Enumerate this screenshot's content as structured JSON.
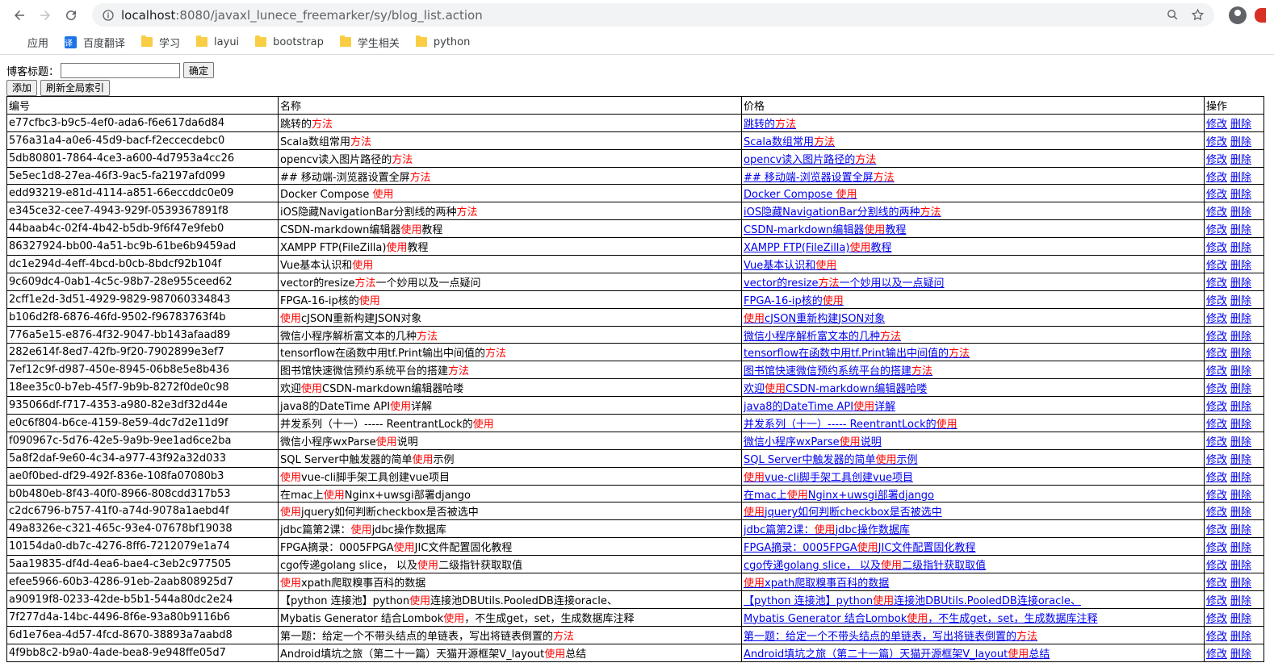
{
  "browser": {
    "url_host": "localhost",
    "url_path": ":8080/javaxl_lunece_freemarker/sy/blog_list.action",
    "bookmarks": [
      {
        "label": "应用",
        "icon": "apps-icon"
      },
      {
        "label": "百度翻译",
        "icon": "translate-icon"
      },
      {
        "label": "学习",
        "icon": "folder-icon"
      },
      {
        "label": "layui",
        "icon": "folder-icon"
      },
      {
        "label": "bootstrap",
        "icon": "folder-icon"
      },
      {
        "label": "学生相关",
        "icon": "folder-icon"
      },
      {
        "label": "python",
        "icon": "folder-icon"
      }
    ]
  },
  "search": {
    "label": "博客标题：",
    "value": "",
    "submit_label": "确定"
  },
  "actions": {
    "add_label": "添加",
    "refresh_label": "刷新全局索引"
  },
  "table": {
    "headers": [
      "编号",
      "名称",
      "价格",
      "操作"
    ],
    "edit_label": "修改",
    "delete_label": "删除",
    "highlight_color": "#ff0000",
    "rows": [
      {
        "id": "e77cfbc3-b9c5-4ef0-ada6-f6e617da6d84",
        "name": [
          [
            "跳转的",
            false
          ],
          [
            "方法",
            true
          ]
        ]
      },
      {
        "id": "576a31a4-a0e6-45d9-bacf-f2eccecdebc0",
        "name": [
          [
            "Scala数组常用",
            false
          ],
          [
            "方法",
            true
          ]
        ]
      },
      {
        "id": "5db80801-7864-4ce3-a600-4d7953a4cc26",
        "name": [
          [
            "opencv读入图片路径的",
            false
          ],
          [
            "方法",
            true
          ]
        ]
      },
      {
        "id": "5e5ec1d8-27ea-46f3-9ac5-fa2197afd099",
        "name": [
          [
            "## 移动端-浏览器设置全屏",
            false
          ],
          [
            "方法",
            true
          ]
        ]
      },
      {
        "id": "edd93219-e81d-4114-a851-66eccddc0e09",
        "name": [
          [
            "Docker Compose ",
            false
          ],
          [
            "使用",
            true
          ]
        ]
      },
      {
        "id": "e345ce32-cee7-4943-929f-0539367891f8",
        "name": [
          [
            "iOS隐藏NavigationBar分割线的两种",
            false
          ],
          [
            "方法",
            true
          ]
        ]
      },
      {
        "id": "44baab4c-02f4-4b42-b5db-9f6f47e9feb0",
        "name": [
          [
            "CSDN-markdown编辑器",
            false
          ],
          [
            "使用",
            true
          ],
          [
            "教程",
            false
          ]
        ]
      },
      {
        "id": "86327924-bb00-4a51-bc9b-61be6b9459ad",
        "name": [
          [
            "XAMPP FTP(FileZilla)",
            false
          ],
          [
            "使用",
            true
          ],
          [
            "教程",
            false
          ]
        ]
      },
      {
        "id": "dc1e294d-4eff-4bcd-b0cb-8bdcf92b104f",
        "name": [
          [
            "Vue基本认识和",
            false
          ],
          [
            "使用",
            true
          ]
        ]
      },
      {
        "id": "9c609dc4-0ab1-4c5c-98b7-28e955ceed62",
        "name": [
          [
            "vector的resize",
            false
          ],
          [
            "方法",
            true
          ],
          [
            "一个妙用以及一点疑问",
            false
          ]
        ]
      },
      {
        "id": "2cff1e2d-3d51-4929-9829-987060334843",
        "name": [
          [
            "FPGA-16-ip核的",
            false
          ],
          [
            "使用",
            true
          ]
        ]
      },
      {
        "id": "b106d2f8-6876-46fd-9502-f96783763f4b",
        "name": [
          [
            "使用",
            true
          ],
          [
            "cJSON重新构建JSON对象",
            false
          ]
        ]
      },
      {
        "id": "776a5e15-e876-4f32-9047-bb143afaad89",
        "name": [
          [
            "微信小程序解析富文本的几种",
            false
          ],
          [
            "方法",
            true
          ]
        ]
      },
      {
        "id": "282e614f-8ed7-42fb-9f20-7902899e3ef7",
        "name": [
          [
            "tensorflow在函数中用tf.Print输出中间值的",
            false
          ],
          [
            "方法",
            true
          ]
        ]
      },
      {
        "id": "7ef12c9f-d987-450e-8945-06b8e5e8b436",
        "name": [
          [
            "图书馆快速微信预约系统平台的搭建",
            false
          ],
          [
            "方法",
            true
          ]
        ]
      },
      {
        "id": "18ee35c0-b7eb-45f7-9b9b-8272f0de0c98",
        "name": [
          [
            "欢迎",
            false
          ],
          [
            "使用",
            true
          ],
          [
            "CSDN-markdown编辑器哈喽",
            false
          ]
        ]
      },
      {
        "id": "935066df-f717-4353-a980-82e3df32d44e",
        "name": [
          [
            "java8的DateTime API",
            false
          ],
          [
            "使用",
            true
          ],
          [
            "详解",
            false
          ]
        ]
      },
      {
        "id": "e0c6f804-b6ce-4159-8e59-4dc7d2e11d9f",
        "name": [
          [
            "并发系列（十一）----- ReentrantLock的",
            false
          ],
          [
            "使用",
            true
          ]
        ]
      },
      {
        "id": "f090967c-5d76-42e5-9a9b-9ee1ad6ce2ba",
        "name": [
          [
            "微信小程序wxParse",
            false
          ],
          [
            "使用",
            true
          ],
          [
            "说明",
            false
          ]
        ]
      },
      {
        "id": "5a8f2daf-9e60-4c34-a977-43f92a32d033",
        "name": [
          [
            "SQL Server中触发器的简单",
            false
          ],
          [
            "使用",
            true
          ],
          [
            "示例",
            false
          ]
        ]
      },
      {
        "id": "ae0f0bed-df29-492f-836e-108fa07080b3",
        "name": [
          [
            "使用",
            true
          ],
          [
            "vue-cli脚手架工具创建vue项目",
            false
          ]
        ]
      },
      {
        "id": "b0b480eb-8f43-40f0-8966-808cdd317b53",
        "name": [
          [
            "在mac上",
            false
          ],
          [
            "使用",
            true
          ],
          [
            "Nginx+uwsgi部署django",
            false
          ]
        ]
      },
      {
        "id": "c2dc6796-b757-41f0-a74d-9078a1aebd4f",
        "name": [
          [
            "使用",
            true
          ],
          [
            "jquery如何判断checkbox是否被选中",
            false
          ]
        ]
      },
      {
        "id": "49a8326e-c321-465c-93e4-07678bf19038",
        "name": [
          [
            "jdbc篇第2课：",
            false
          ],
          [
            "使用",
            true
          ],
          [
            "jdbc操作数据库",
            false
          ]
        ]
      },
      {
        "id": "10154da0-db7c-4276-8ff6-7212079e1a74",
        "name": [
          [
            "FPGA摘录：0005FPGA",
            false
          ],
          [
            "使用",
            true
          ],
          [
            "JIC文件配置固化教程",
            false
          ]
        ]
      },
      {
        "id": "5aa19835-df4d-4ea6-bae4-c3eb2c977505",
        "name": [
          [
            "cgo传递golang slice， 以及",
            false
          ],
          [
            "使用",
            true
          ],
          [
            "二级指针获取取值",
            false
          ]
        ]
      },
      {
        "id": "efee5966-60b3-4286-91eb-2aab808925d7",
        "name": [
          [
            "使用",
            true
          ],
          [
            "xpath爬取糗事百科的数据",
            false
          ]
        ]
      },
      {
        "id": "a90919f8-0233-42de-b5b1-544a80dc2e24",
        "name": [
          [
            "【python 连接池】python",
            false
          ],
          [
            "使用",
            true
          ],
          [
            "连接池DBUtils.PooledDB连接oracle、",
            false
          ]
        ]
      },
      {
        "id": "7f277d4a-14bc-4496-8f6e-93a80b9116b6",
        "name": [
          [
            "Mybatis Generator 结合Lombok",
            false
          ],
          [
            "使用",
            true
          ],
          [
            "，不生成get，set，生成数据库注释",
            false
          ]
        ]
      },
      {
        "id": "6d1e76ea-4d57-4fcd-8670-38893a7aabd8",
        "name": [
          [
            "第一题：给定一个不带头结点的单链表，写出将链表倒置的",
            false
          ],
          [
            "方法",
            true
          ]
        ]
      },
      {
        "id": "4f9bb8c2-b9a0-4ade-bea8-9e948ffe05d7",
        "name": [
          [
            "Android填坑之旅（第二十一篇）天猫开源框架V_layout",
            false
          ],
          [
            "使用",
            true
          ],
          [
            "总结",
            false
          ]
        ]
      }
    ]
  }
}
